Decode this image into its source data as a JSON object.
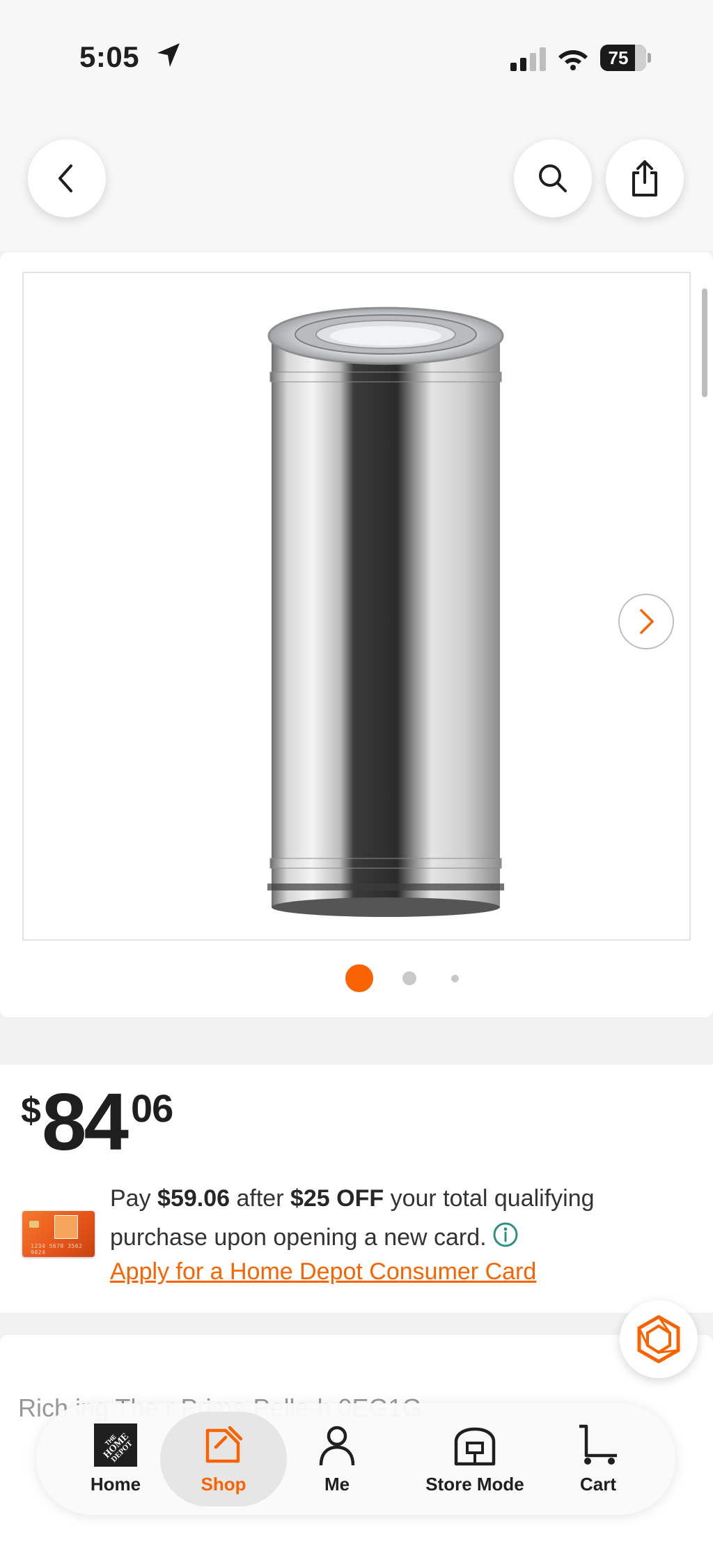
{
  "status_bar": {
    "time": "5:05",
    "battery": "75",
    "battery_level": 0.75
  },
  "header": {
    "icons": [
      "chevron-left-icon",
      "search-icon",
      "share-icon"
    ]
  },
  "gallery": {
    "image_count": 3,
    "active_index": 0,
    "accent_color": "#f96302"
  },
  "price": {
    "currency": "$",
    "dollars": "84",
    "cents": "06"
  },
  "promo": {
    "pay_prefix": "Pay ",
    "pay_amount": "$59.06",
    "after": " after ",
    "discount": "$25 OFF",
    "rest": " your total qualifying purchase upon opening a new card.",
    "apply_link": "Apply for a Home Depot Consumer Card",
    "card_number": "1234 5678 3562 9024"
  },
  "next_section": {
    "partial_title": "Rich ing The r Prima Pelle-h 0EG1G"
  },
  "tab_bar": {
    "tabs": [
      {
        "label": "Home",
        "icon": "home-depot-logo-icon"
      },
      {
        "label": "Shop",
        "icon": "shop-tag-icon",
        "active": true
      },
      {
        "label": "Me",
        "icon": "person-icon"
      },
      {
        "label": "Store Mode",
        "icon": "store-icon"
      },
      {
        "label": "Cart",
        "icon": "cart-icon"
      }
    ]
  }
}
